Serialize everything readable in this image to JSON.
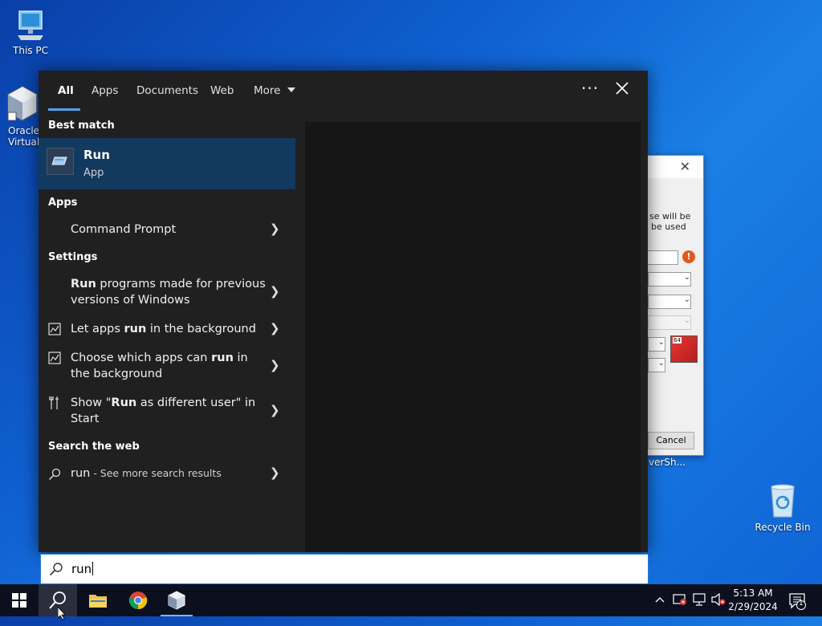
{
  "desktop": {
    "icons": [
      {
        "label": "This PC"
      },
      {
        "label_line1": "Oracle",
        "label_line2": "Virtualt"
      },
      {
        "label": "Recycle Bin"
      }
    ],
    "background_window": {
      "text_line1": "se will be",
      "text_line2": "be used",
      "cancel_label": "Cancel",
      "badge_64": "64",
      "desktop_label": "verSh..."
    }
  },
  "search": {
    "tabs": [
      "All",
      "Apps",
      "Documents",
      "Web",
      "More"
    ],
    "active_tab": "All",
    "sections": {
      "best_match": "Best match",
      "apps": "Apps",
      "settings": "Settings",
      "search_web": "Search the web"
    },
    "best_match": {
      "title": "Run",
      "subtitle": "App"
    },
    "apps": [
      {
        "label": "Command Prompt"
      }
    ],
    "settings": [
      {
        "bold": "Run",
        "rest": " programs made for previous",
        "line2": "versions of Windows"
      },
      {
        "pre": "Let apps ",
        "bold": "run",
        "rest": " in the background"
      },
      {
        "pre": "Choose which apps can ",
        "bold": "run",
        "rest": " in",
        "line2": "the background"
      },
      {
        "pre": "Show \"",
        "bold": "Run",
        "rest": " as different user\" in",
        "line2": "Start"
      }
    ],
    "web": {
      "query": "run",
      "suffix": " - See more search results"
    },
    "input_value": "run"
  },
  "taskbar": {
    "time": "5:13 AM",
    "date": "2/29/2024",
    "notification_count": "1"
  },
  "colors": {
    "accent": "#4ea3f1",
    "best_match_bg": "#12395e",
    "panel_bg": "#202020",
    "taskbar_bg": "#0b0f1e"
  }
}
